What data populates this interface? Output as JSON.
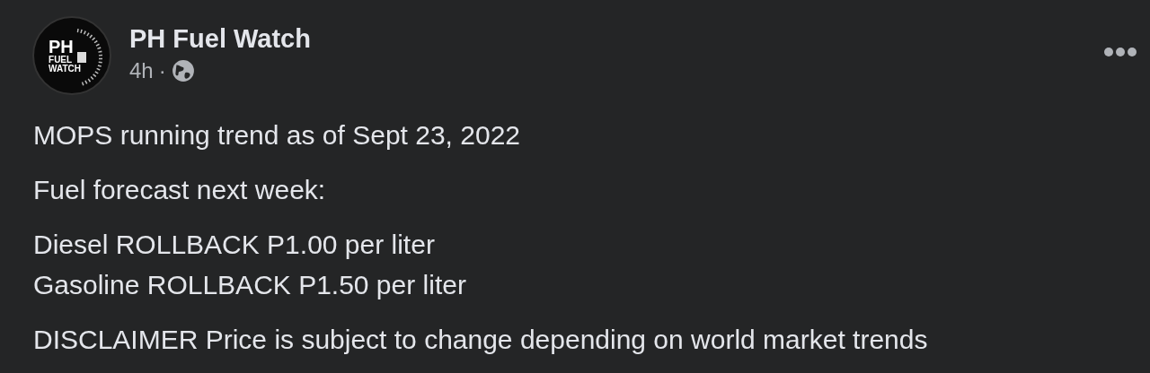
{
  "post": {
    "avatar": {
      "logo_text": [
        "PH",
        "FUEL",
        "WATCH"
      ]
    },
    "author": "PH Fuel Watch",
    "time": "4h",
    "separator": "·",
    "paragraphs": [
      [
        "MOPS running trend as of Sept 23, 2022"
      ],
      [
        "Fuel forecast next week:"
      ],
      [
        "Diesel ROLLBACK P1.00 per liter",
        "Gasoline ROLLBACK P1.50 per liter"
      ],
      [
        "DISCLAIMER Price is subject to change depending on world market trends"
      ]
    ]
  }
}
